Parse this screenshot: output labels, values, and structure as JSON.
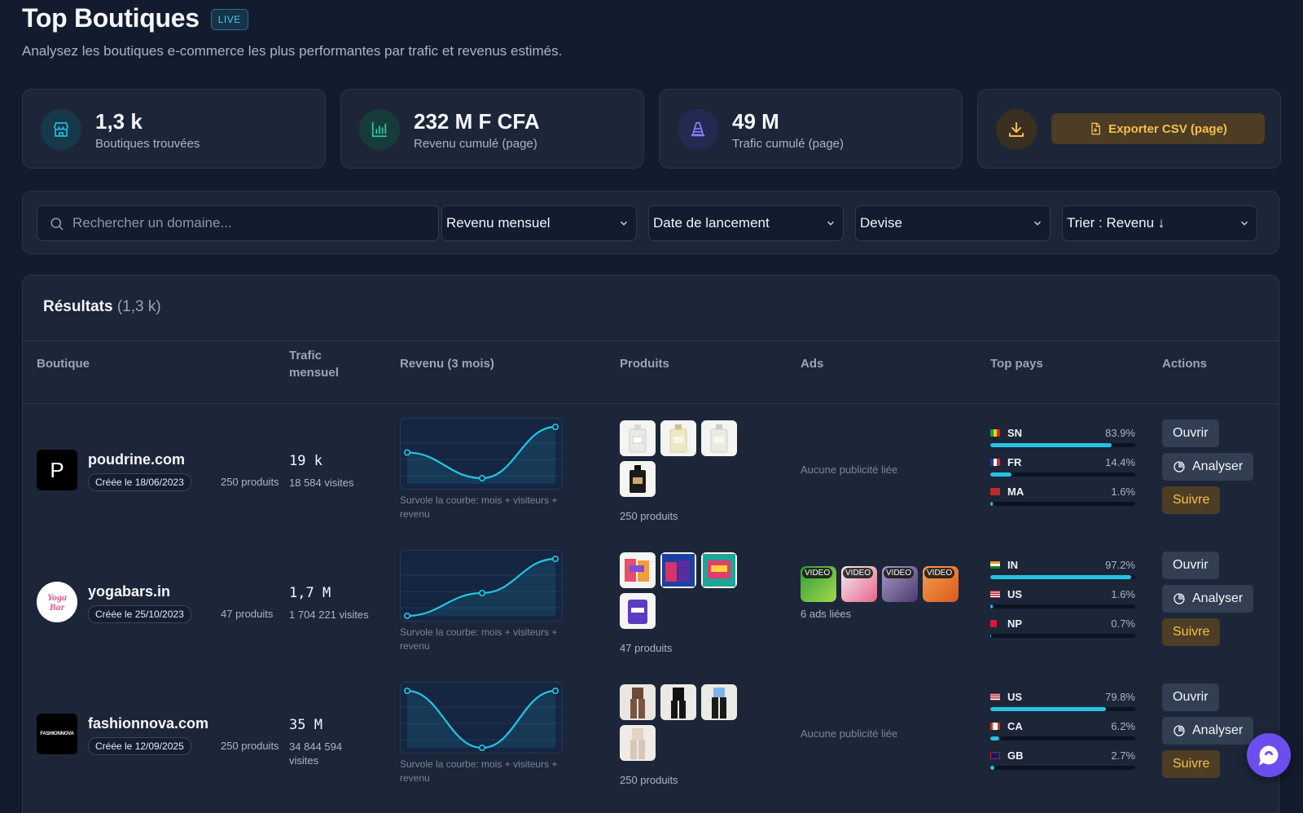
{
  "header": {
    "title": "Top Boutiques",
    "badge": "LIVE",
    "subtitle": "Analysez les boutiques e-commerce les plus performantes par trafic et revenus estimés."
  },
  "stats": [
    {
      "value": "1,3 k",
      "label": "Boutiques trouvées",
      "icon": "store-icon",
      "color": "#22b8d8"
    },
    {
      "value": "232 M F CFA",
      "label": "Revenu cumulé (page)",
      "icon": "bar-chart-icon",
      "color": "#2ec4a0"
    },
    {
      "value": "49 M",
      "label": "Trafic cumulé (page)",
      "icon": "traffic-cone-icon",
      "color": "#7b83f3"
    }
  ],
  "export": {
    "label": "Exporter CSV (page)",
    "icon": "download-icon",
    "color": "#f3c04a"
  },
  "filters": {
    "search_placeholder": "Rechercher un domaine...",
    "revenue": "Revenu mensuel",
    "launch_date": "Date de lancement",
    "currency": "Devise",
    "sort": "Trier : Revenu ↓"
  },
  "results": {
    "title": "Résultats",
    "count": "(1,3 k)",
    "columns": {
      "shop": "Boutique",
      "traffic": "Trafic mensuel",
      "revenue": "Revenu (3 mois)",
      "products": "Produits",
      "ads": "Ads",
      "countries": "Top pays",
      "actions": "Actions"
    },
    "chart_hint": "Survole la courbe: mois + visiteurs + revenu",
    "rows": [
      {
        "domain": "poudrine.com",
        "created": "Créée le 18/06/2023",
        "products_label": "250 produits",
        "traffic": "19 k",
        "visits": "18 584 visites",
        "revenue_curve": [
          0.55,
          0.1,
          1.0
        ],
        "products_footer": "250 produits",
        "ads_text": "Aucune publicité liée",
        "countries": [
          {
            "code": "SN",
            "pct": "83.9%",
            "value": 83.9
          },
          {
            "code": "FR",
            "pct": "14.4%",
            "value": 14.4
          },
          {
            "code": "MA",
            "pct": "1.6%",
            "value": 1.6
          }
        ]
      },
      {
        "domain": "yogabars.in",
        "created": "Créée le 25/10/2023",
        "products_label": "47 produits",
        "traffic": "1,7 M",
        "visits": "1 704 221 visites",
        "revenue_curve": [
          0.0,
          0.4,
          1.0
        ],
        "products_footer": "47 produits",
        "ads_tag": "VIDEO",
        "ads_text": "6 ads liées",
        "countries": [
          {
            "code": "IN",
            "pct": "97.2%",
            "value": 97.2
          },
          {
            "code": "US",
            "pct": "1.6%",
            "value": 1.6
          },
          {
            "code": "NP",
            "pct": "0.7%",
            "value": 0.7
          }
        ]
      },
      {
        "domain": "fashionnova.com",
        "created": "Créée le 12/09/2025",
        "products_label": "250 produits",
        "traffic": "35 M",
        "visits": "34 844 594 visites",
        "revenue_curve": [
          1.0,
          0.0,
          1.0
        ],
        "products_footer": "250 produits",
        "ads_text": "Aucune publicité liée",
        "countries": [
          {
            "code": "US",
            "pct": "79.8%",
            "value": 79.8
          },
          {
            "code": "CA",
            "pct": "6.2%",
            "value": 6.2
          },
          {
            "code": "GB",
            "pct": "2.7%",
            "value": 2.7
          }
        ]
      }
    ],
    "actions": {
      "open": "Ouvrir",
      "analyze": "Analyser",
      "follow": "Suivre"
    }
  },
  "logos": {
    "poudrine": "P",
    "fashionnova": "FASHIONNOVA",
    "yogabars": "Yoga Bar"
  }
}
